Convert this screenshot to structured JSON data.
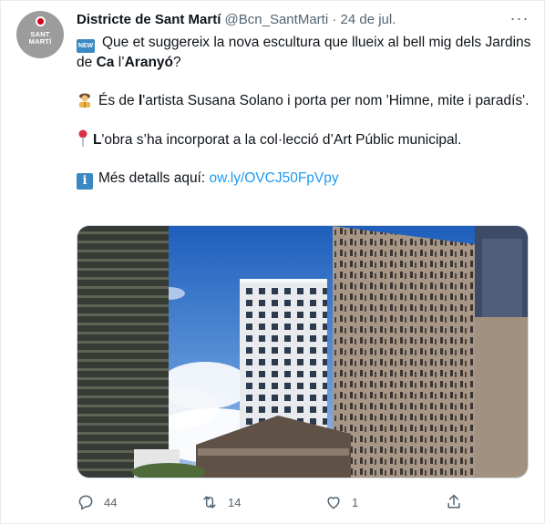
{
  "tweet": {
    "avatar": {
      "line1": "SANT",
      "line2": "MARTÍ",
      "accent": "#d0021b"
    },
    "author_name": "Districte de Sant Martí",
    "handle": "@Bcn_SantMarti",
    "separator": "·",
    "date": "24 de jul.",
    "more_icon": "more-horizontal-icon",
    "more_glyph": "···",
    "new_badge": "NEW",
    "info_glyph": "i",
    "para1": {
      "pre": "Que et suggereix la nova escultura que llueix al bell mig dels Jardins de ",
      "bold1": "Ca",
      "mid": " l’",
      "bold2": "Aranyó",
      "post": "?"
    },
    "para2": {
      "pre": "És de ",
      "bold": "l",
      "post": "'artista Susana Solano i porta per nom 'Himne, mite i paradís'."
    },
    "para3": {
      "bold": "L",
      "post": "'obra s’ha incorporat a la col·lecció d’Art Públic municipal."
    },
    "para4": {
      "pre": "Més detalls aquí: ",
      "link": "ow.ly/OVCJ50FpVpy"
    },
    "colors": {
      "link": "#1d9bf0",
      "muted": "#536471",
      "emoji_blue": "#3b88c3"
    },
    "actions": {
      "reply_count": "44",
      "retweet_count": "14",
      "like_count": "1"
    }
  }
}
